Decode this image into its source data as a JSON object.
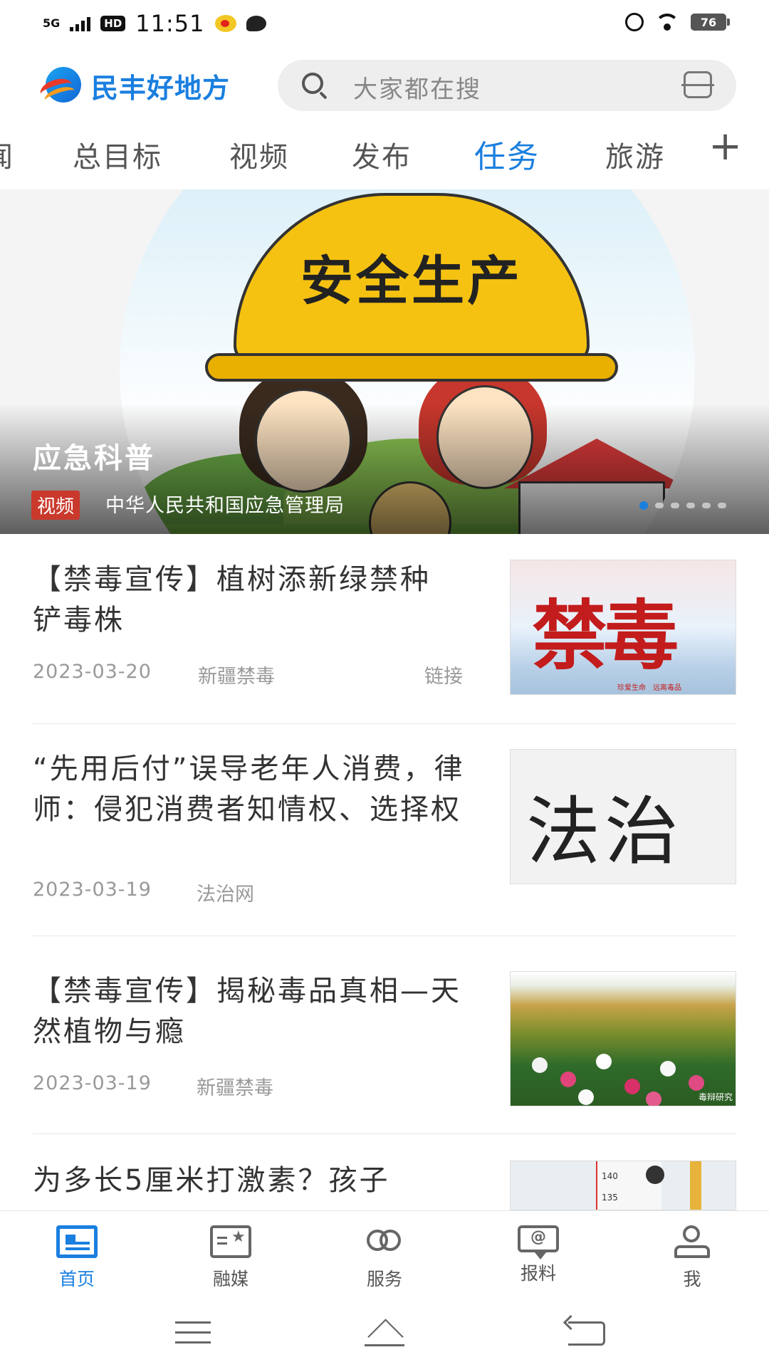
{
  "status_bar": {
    "network": "5G",
    "hd": "HD",
    "time": "11:51",
    "battery": "76"
  },
  "header": {
    "app_name": "民丰好地方",
    "search_placeholder": "大家都在搜"
  },
  "tabs": [
    {
      "label": "闻"
    },
    {
      "label": "总目标"
    },
    {
      "label": "视频"
    },
    {
      "label": "发布"
    },
    {
      "label": "任务",
      "active": true
    },
    {
      "label": "旅游"
    }
  ],
  "tab_add": "+",
  "banner": {
    "image_text": "安全生产",
    "title": "应急科普",
    "tag": "视频",
    "source": "中华人民共和国应急管理局",
    "page_count": 6,
    "active_index": 0
  },
  "news": [
    {
      "title": "【禁毒宣传】植树添新绿禁种铲毒株",
      "date": "2023-03-20",
      "source": "新疆禁毒",
      "link_label": "链接",
      "thumb_text": "禁毒",
      "thumb_subtext": "珍爱生命　远离毒品"
    },
    {
      "title": "“先用后付”误导老年人消费，律师：侵犯消费者知情权、选择权",
      "date": "2023-03-19",
      "source": "法治网",
      "thumb_text": "法治"
    },
    {
      "title": "【禁毒宣传】揭秘毒品真相—天然植物与瘾",
      "date": "2023-03-19",
      "source": "新疆禁毒",
      "thumb_watermark": "毒辩研究"
    },
    {
      "title": "为多长5厘米打激素？孩子",
      "thumb_ticks": [
        "140",
        "135"
      ]
    }
  ],
  "bottom_nav": [
    {
      "label": "首页",
      "icon": "home-news-icon",
      "active": true
    },
    {
      "label": "融媒",
      "icon": "media-icon"
    },
    {
      "label": "服务",
      "icon": "service-heart-icon"
    },
    {
      "label": "报料",
      "icon": "report-icon"
    },
    {
      "label": "我",
      "icon": "profile-icon"
    }
  ],
  "colors": {
    "accent": "#1a7fdf",
    "tag_red": "#c9392c"
  }
}
